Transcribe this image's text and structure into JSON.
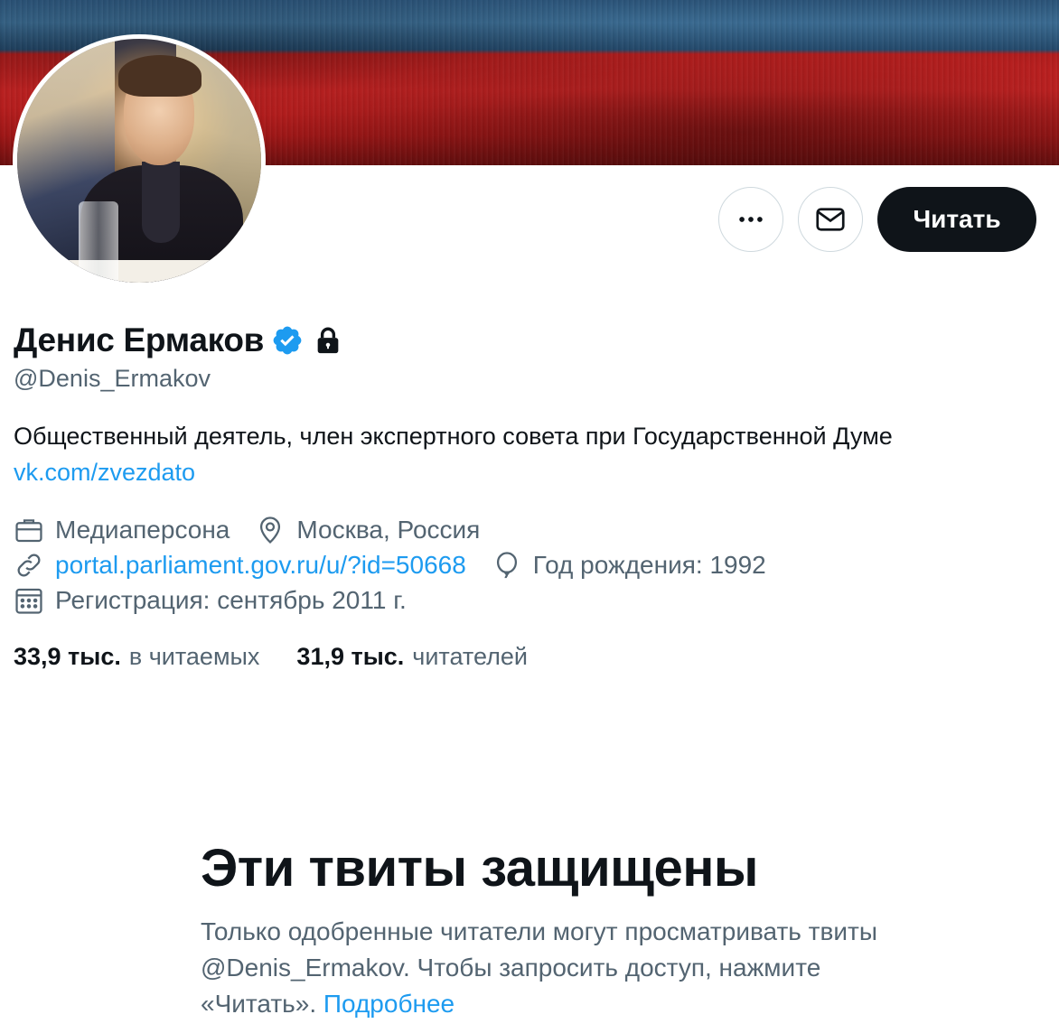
{
  "profile": {
    "name": "Денис Ермаков",
    "handle": "@Denis_Ermakov",
    "bio": "Общественный деятель, член экспертного совета при Государственной Думе",
    "bio_link": "vk.com/zvezdato",
    "category": "Медиаперсона",
    "location": "Москва, Россия",
    "website": "portal.parliament.gov.ru/u/?id=50668",
    "birthday": "Год рождения: 1992",
    "joined": "Регистрация: сентябрь 2011 г.",
    "verified": true,
    "protected": true
  },
  "actions": {
    "more_icon": "more-icon",
    "message_icon": "mail-icon",
    "follow_label": "Читать"
  },
  "stats": {
    "following_count": "33,9 тыс.",
    "following_label": "в читаемых",
    "followers_count": "31,9 тыс.",
    "followers_label": "читателей"
  },
  "protected_notice": {
    "title": "Эти твиты защищены",
    "text": "Только одобренные читатели могут просматривать твиты @Denis_Ermakov. Чтобы запросить доступ, нажмите «Читать».",
    "more_link": "Подробнее"
  },
  "colors": {
    "accent": "#1d9bf0",
    "text_primary": "#0f1419",
    "text_secondary": "#536471",
    "button_dark": "#0f1419"
  }
}
